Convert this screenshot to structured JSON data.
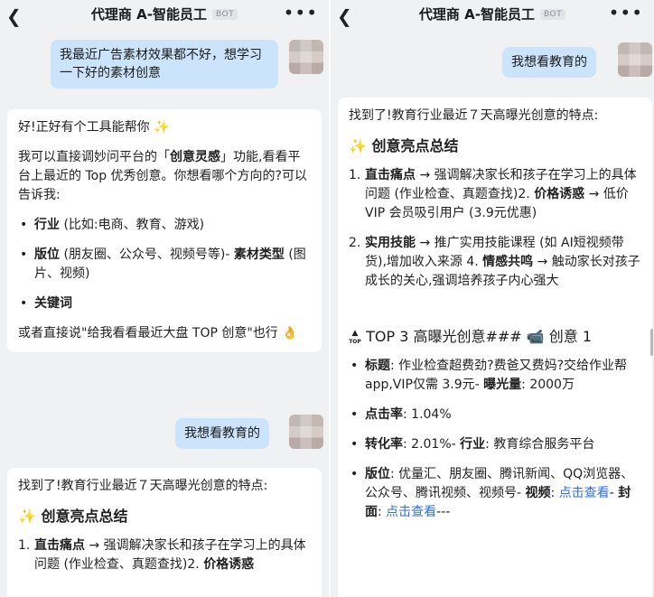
{
  "header": {
    "title": "代理商 A-智能员工",
    "bot_badge": "BOT",
    "back_icon": "chevron-left-icon",
    "more_icon": "more-dots-icon"
  },
  "left": {
    "user_msg_1": "我最近广告素材效果都不好，想学习一下好的素材创意",
    "bot_msg_1": {
      "greet": "好!正好有个工具能帮你 ✨",
      "intro_a": "我可以直接调妙问平台的「",
      "intro_bold": "创意灵感",
      "intro_b": "」功能,看看平台上最近的 Top 优秀创意。你想看哪个方向的?可以告诉我:",
      "items": [
        {
          "bold": "行业",
          "text": " (比如:电商、教育、游戏)"
        },
        {
          "bold": "版位",
          "text": " (朋友圈、公众号、视频号等)- ",
          "bold2": "素材类型",
          "text2": " (图片、视频)"
        },
        {
          "bold": "关键词",
          "text": ""
        }
      ],
      "outro": "或者直接说\"给我看看最近大盘 TOP 创意\"也行 👌"
    },
    "user_msg_2": "我想看教育的",
    "bot_msg_2": {
      "intro": "找到了!教育行业最近７天高曝光创意的特点:",
      "heading": "✨ 创意亮点总结",
      "item1_label": "直击痛点",
      "item1_text": " → 强调解决家长和孩子在学习上的具体问题 (作业检查、真题查找)2. ",
      "item1_label2": "价格诱惑"
    }
  },
  "right": {
    "user_msg": "我想看教育的",
    "bot_msg": {
      "intro": "找到了!教育行业最近７天高曝光创意的特点:",
      "heading": "✨ 创意亮点总结",
      "point1": {
        "num": "1.",
        "label": "直击痛点",
        "text": " → 强调解决家长和孩子在学习上的具体问题 (作业检查、真题查找)2. ",
        "label2": "价格诱惑",
        "text2": " → 低价 VIP 会员吸引用户 (3.9元优惠)"
      },
      "point2": {
        "num": "2.",
        "label": "实用技能",
        "text": " → 推广实用技能课程 (如 AI短视频带货),增加收入来源 4. ",
        "label2": "情感共鸣",
        "text2": " → 触动家长对孩子成长的关心,强调培养孩子内心强大"
      },
      "top_heading": "TOP 3 高曝光创意### 📹 创意 1",
      "top_icon": "top-arrow-icon",
      "items": [
        {
          "bold": "标题",
          "text": ": 作业检查超费劲?费爸又费妈?交给作业帮 app,VIP仅需 3.9元- ",
          "bold2": "曝光量",
          "text2": ": 2000万"
        },
        {
          "bold": "点击率",
          "text": ": 1.04%"
        },
        {
          "bold": "转化率",
          "text": ": 2.01%- ",
          "bold2": "行业",
          "text2": ": 教育综合服务平台"
        },
        {
          "bold": "版位",
          "text": ": 优量汇、朋友圈、腾讯新闻、QQ浏览器、公众号、腾讯视频、视频号- ",
          "bold2": "视频",
          "text2": ": "
        }
      ],
      "link_view": "点击查看",
      "cover_sep": "- ",
      "cover_label": "封面",
      "cover_colon": ": ",
      "tail": "---"
    }
  },
  "colors": {
    "user_bubble": "#cce4fb",
    "link": "#2f6fe0",
    "background": "#f0f1f3"
  }
}
